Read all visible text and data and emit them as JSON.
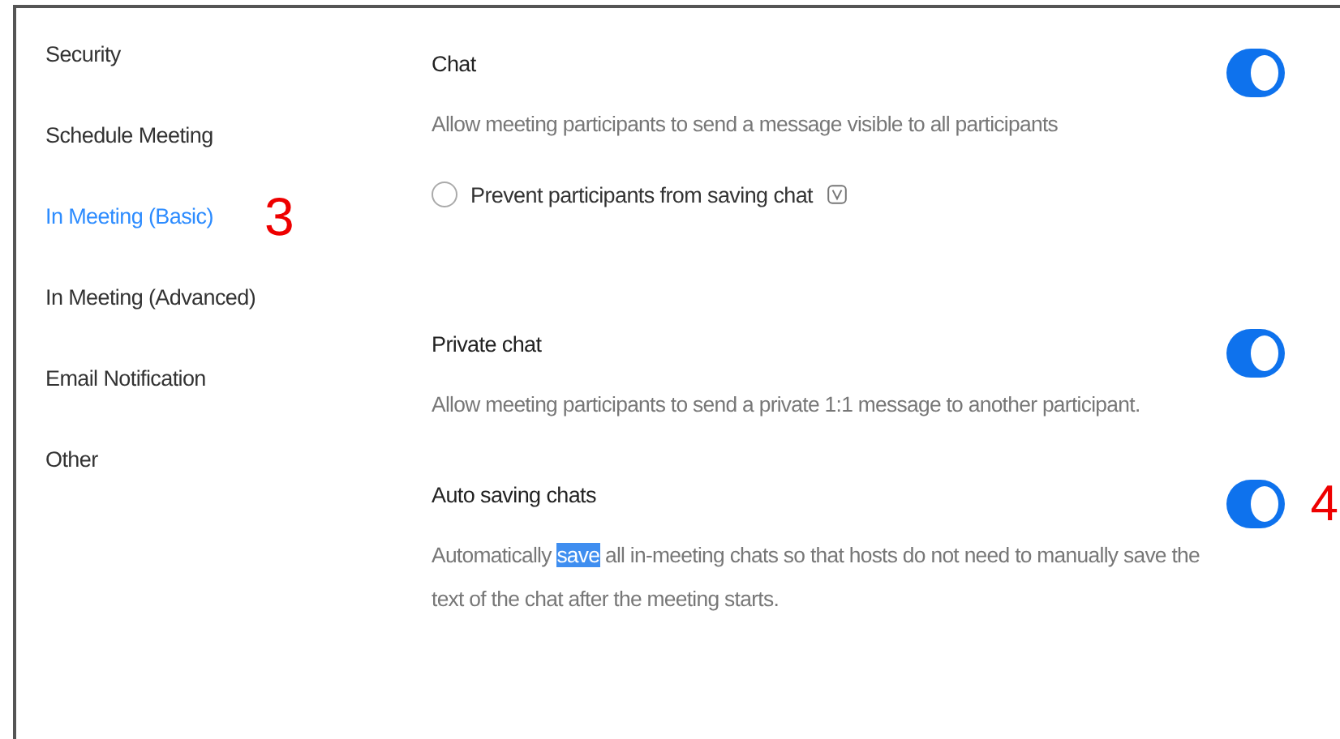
{
  "sidebar": {
    "items": [
      {
        "label": "Security",
        "selected": false
      },
      {
        "label": "Schedule Meeting",
        "selected": false
      },
      {
        "label": "In Meeting (Basic)",
        "selected": true,
        "annotation": "3"
      },
      {
        "label": "In Meeting (Advanced)",
        "selected": false
      },
      {
        "label": "Email Notification",
        "selected": false
      },
      {
        "label": "Other",
        "selected": false
      }
    ]
  },
  "settings": [
    {
      "title": "Chat",
      "description": [
        {
          "text": "Allow meeting participants to send a message visible to all participants",
          "highlighted": false
        }
      ],
      "on": true,
      "options": [
        {
          "label": "Prevent participants from saving chat",
          "checked": false
        }
      ]
    },
    {
      "title": "Private chat",
      "description": [
        {
          "text": "Allow meeting participants to send a private 1:1 message to another participant.",
          "highlighted": false
        }
      ],
      "on": true
    },
    {
      "title": "Auto saving chats",
      "description": [
        {
          "text": "Automatically ",
          "highlighted": false
        },
        {
          "text": "save",
          "highlighted": true
        },
        {
          "text": " all in-meeting chats so that hosts do not need to manually save the text of the chat after the meeting starts.",
          "highlighted": false
        }
      ],
      "on": true,
      "annotation": "4"
    }
  ]
}
